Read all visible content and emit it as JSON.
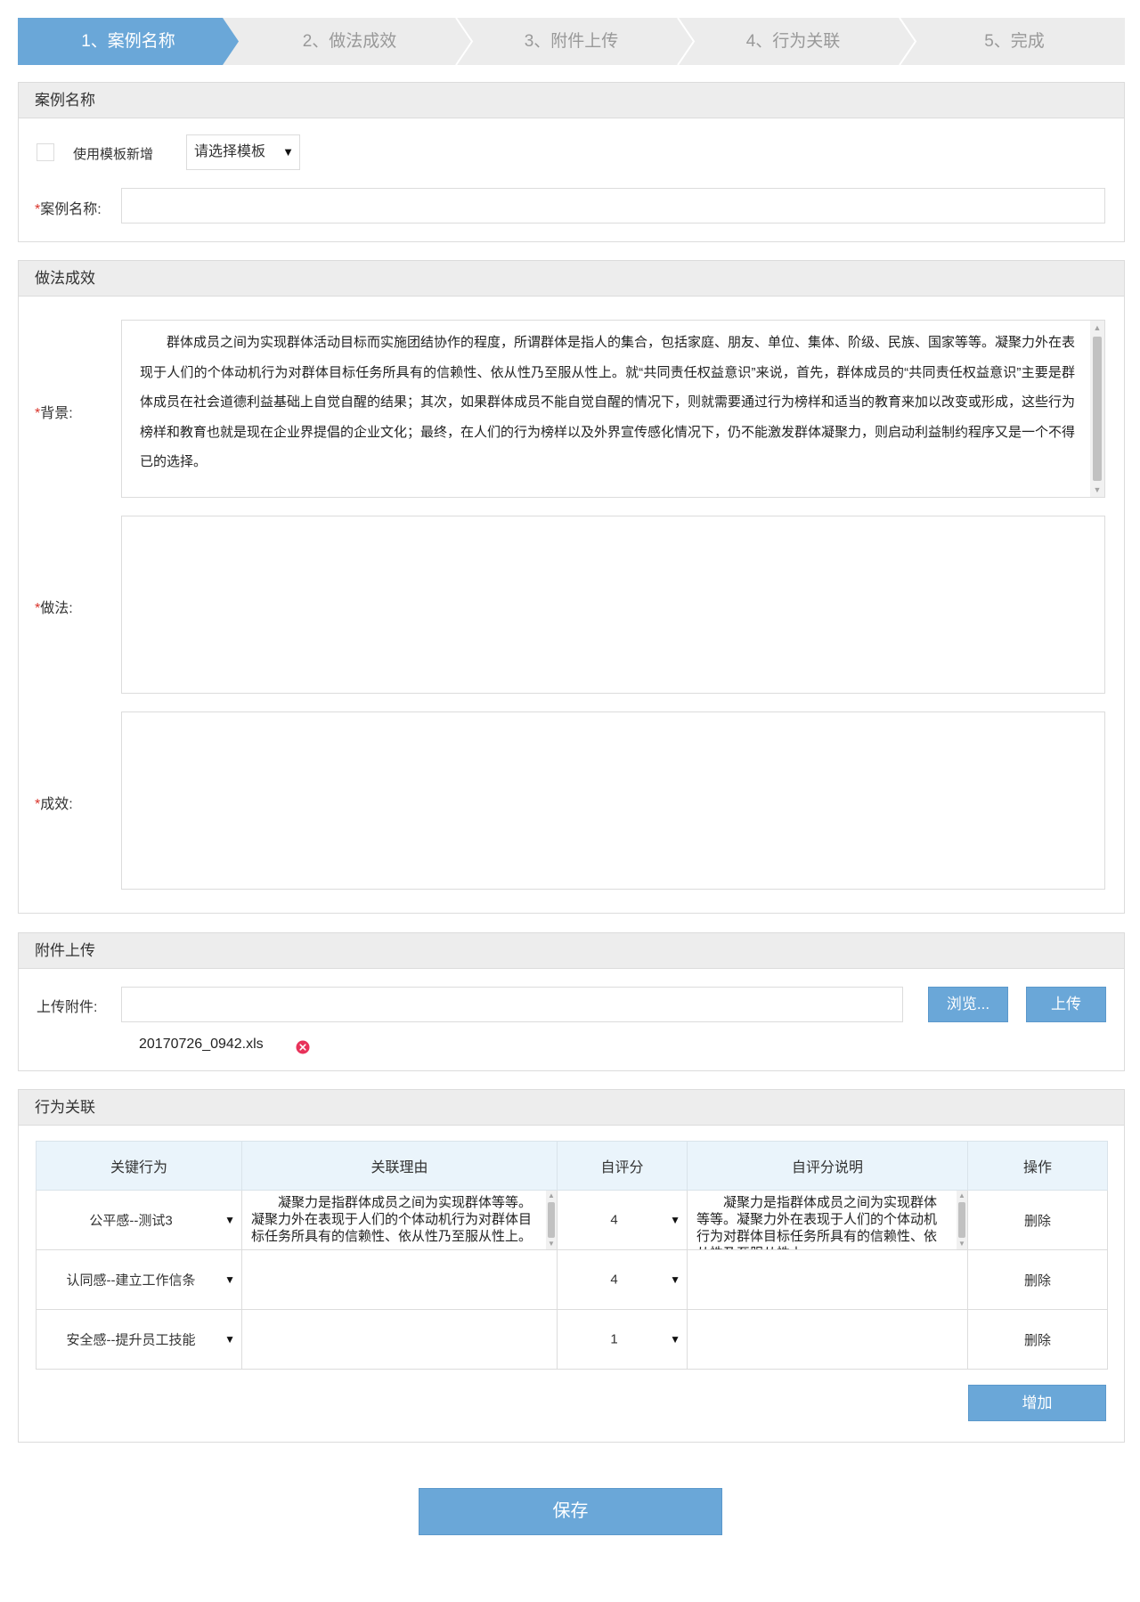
{
  "steps": [
    {
      "label": "1、案例名称",
      "active": true
    },
    {
      "label": "2、做法成效",
      "active": false
    },
    {
      "label": "3、附件上传",
      "active": false
    },
    {
      "label": "4、行为关联",
      "active": false
    },
    {
      "label": "5、完成",
      "active": false
    }
  ],
  "case_name": {
    "title": "案例名称",
    "use_template_label": "使用模板新增",
    "template_select_value": "请选择模板",
    "required_mark": "*",
    "name_label": "案例名称:",
    "name_value": ""
  },
  "practice": {
    "title": "做法成效",
    "required_mark": "*",
    "background_label": "背景:",
    "background_text": "群体成员之间为实现群体活动目标而实施团结协作的程度，所谓群体是指人的集合，包括家庭、朋友、单位、集体、阶级、民族、国家等等。凝聚力外在表现于人们的个体动机行为对群体目标任务所具有的信赖性、依从性乃至服从性上。就“共同责任权益意识”来说，首先，群体成员的“共同责任权益意识”主要是群体成员在社会道德利益基础上自觉自醒的结果；其次，如果群体成员不能自觉自醒的情况下，则就需要通过行为榜样和适当的教育来加以改变或形成，这些行为榜样和教育也就是现在企业界提倡的企业文化；最终，在人们的行为榜样以及外界宣传感化情况下，仍不能激发群体凝聚力，则启动利益制约程序又是一个不得已的选择。",
    "method_label": "做法:",
    "method_text": "",
    "effect_label": "成效:",
    "effect_text": ""
  },
  "attachment": {
    "title": "附件上传",
    "upload_label": "上传附件:",
    "file_path_value": "",
    "browse_button": "浏览...",
    "upload_button": "上传",
    "uploaded_file": "20170726_0942.xls",
    "remove_icon": "close-circle-icon",
    "remove_color": "#e8325a"
  },
  "behavior": {
    "title": "行为关联",
    "columns": [
      "关键行为",
      "关联理由",
      "自评分",
      "自评分说明",
      "操作"
    ],
    "rows": [
      {
        "behavior": "公平感--测试3",
        "reason": "凝聚力是指群体成员之间为实现群体等等。凝聚力外在表现于人们的个体动机行为对群体目标任务所具有的信赖性、依从性乃至服从性上。",
        "score": "4",
        "score_note": "凝聚力是指群体成员之间为实现群体等等。凝聚力外在表现于人们的个体动机行为对群体目标任务所具有的信赖性、依从性乃至服从性上。",
        "action": "删除"
      },
      {
        "behavior": "认同感--建立工作信条",
        "reason": "",
        "score": "4",
        "score_note": "",
        "action": "删除"
      },
      {
        "behavior": "安全感--提升员工技能",
        "reason": "",
        "score": "1",
        "score_note": "",
        "action": "删除"
      }
    ],
    "add_button": "增加"
  },
  "save_button": "保存",
  "colors": {
    "accent": "#6aa7d8",
    "required": "#d9342b",
    "header_bg": "#ededed",
    "table_header_bg": "#eaf4fb"
  }
}
